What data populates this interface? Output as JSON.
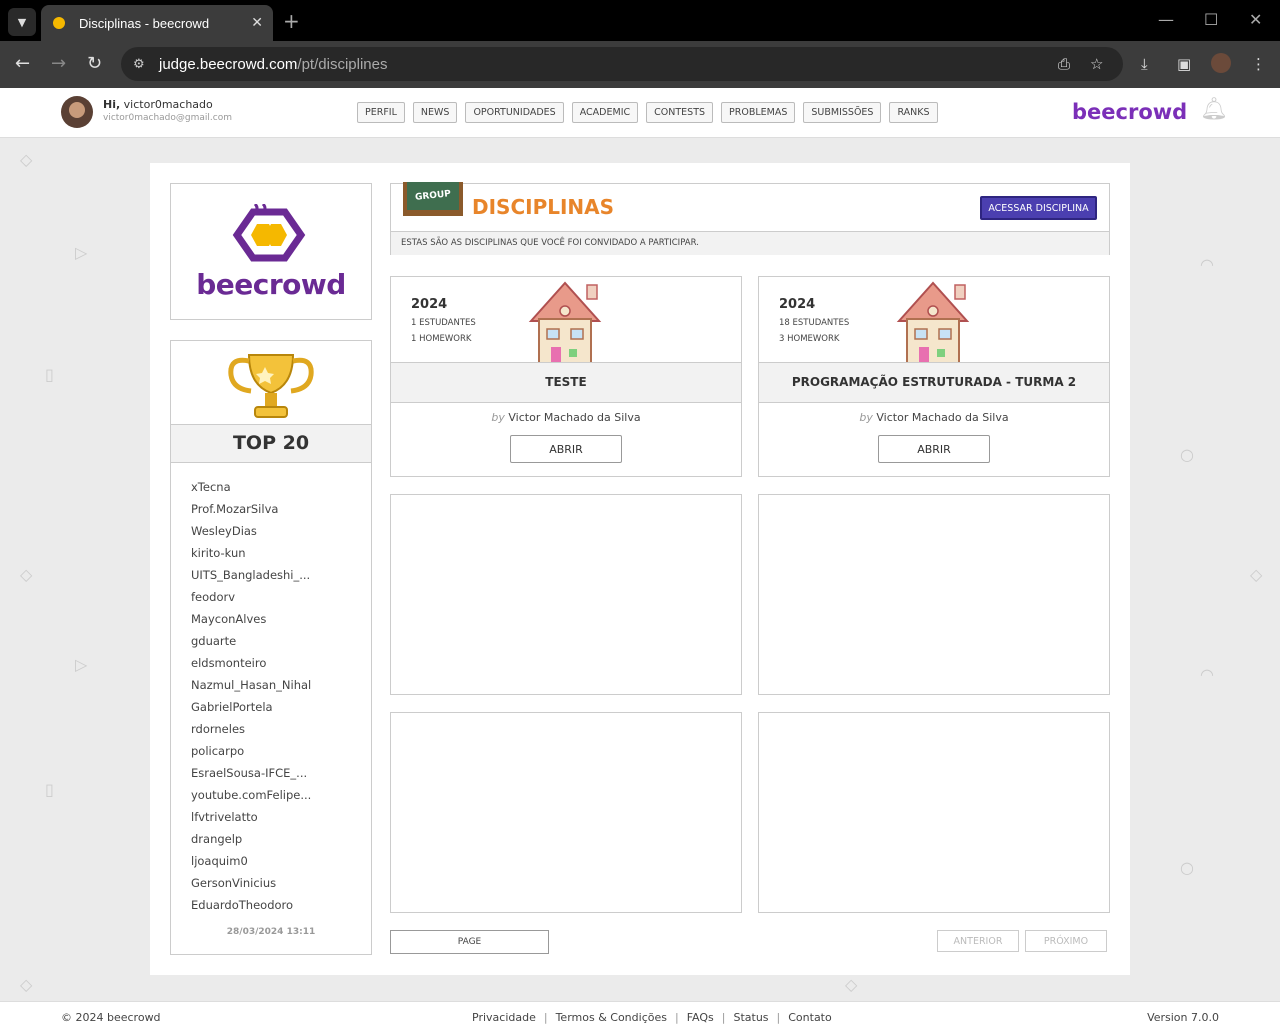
{
  "browser": {
    "tab_title": "Disciplinas - beecrowd",
    "url_host": "judge.beecrowd.com",
    "url_path": "/pt/disciplines"
  },
  "header": {
    "greeting_hi": "Hi,",
    "username": "victor0machado",
    "email": "victor0machado@gmail.com",
    "nav": [
      "PERFIL",
      "NEWS",
      "OPORTUNIDADES",
      "ACADEMIC",
      "CONTESTS",
      "PROBLEMAS",
      "SUBMISSÕES",
      "RANKS"
    ],
    "brand": "beecrowd"
  },
  "sidebar": {
    "logo_text": "beecrowd",
    "top_title": "TOP 20",
    "ranking": [
      "xTecna",
      "Prof.MozarSilva",
      "WesleyDias",
      "kirito-kun",
      "UITS_Bangladeshi_...",
      "feodorv",
      "MayconAlves",
      "gduarte",
      "eldsmonteiro",
      "Nazmul_Hasan_Nihal",
      "GabrielPortela",
      "rdorneles",
      "policarpo",
      "EsraelSousa-IFCE_...",
      "youtube.comFelipe...",
      "lfvtrivelatto",
      "drangelp",
      "ljoaquim0",
      "GersonVinicius",
      "EduardoTheodoro"
    ],
    "updated_at": "28/03/2024 13:11"
  },
  "disciplines": {
    "group_badge": "GROUP",
    "title": "DISCIPLINAS",
    "access_button": "ACESSAR DISCIPLINA",
    "subtitle": "ESTAS SÃO AS DISCIPLINAS QUE VOCÊ FOI CONVIDADO A PARTICIPAR.",
    "cards": [
      {
        "year": "2024",
        "students": "1 ESTUDANTES",
        "homework": "1 HOMEWORK",
        "name": "TESTE",
        "by": "by",
        "author": "Victor Machado da Silva",
        "open": "ABRIR"
      },
      {
        "year": "2024",
        "students": "18 ESTUDANTES",
        "homework": "3 HOMEWORK",
        "name": "PROGRAMAÇÃO ESTRUTURADA - TURMA 2",
        "by": "by",
        "author": "Victor Machado da Silva",
        "open": "ABRIR"
      }
    ],
    "page_button": "PAGE",
    "prev_button": "ANTERIOR",
    "next_button": "PRÓXIMO"
  },
  "footer": {
    "copyright": "© 2024 beecrowd",
    "links": [
      "Privacidade",
      "Termos & Condições",
      "FAQs",
      "Status",
      "Contato"
    ],
    "version": "Version 7.0.0"
  }
}
